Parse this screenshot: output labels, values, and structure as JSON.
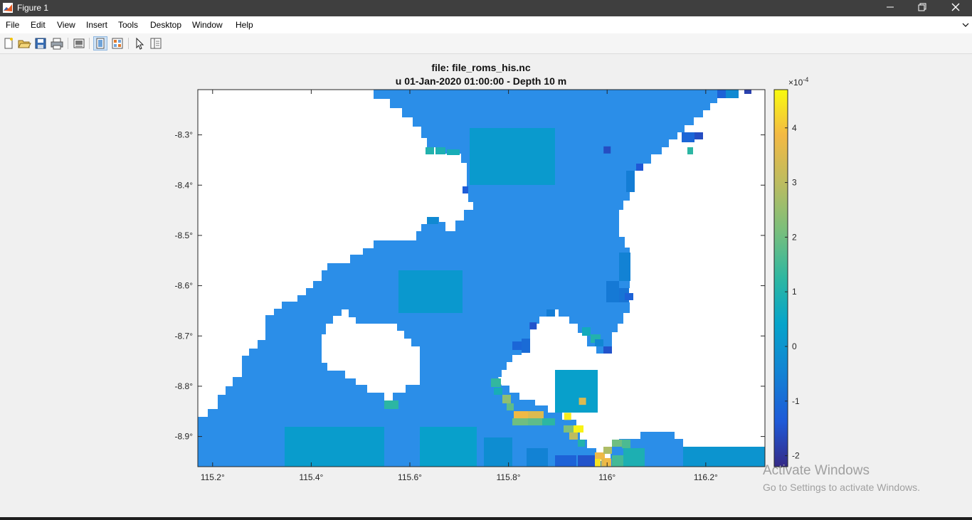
{
  "window": {
    "title": "Figure 1",
    "minimize_icon": "minimize-icon",
    "maximize_icon": "restore-icon",
    "close_icon": "close-icon"
  },
  "menu": {
    "items": [
      "File",
      "Edit",
      "View",
      "Insert",
      "Tools",
      "Desktop",
      "Window",
      "Help"
    ]
  },
  "toolbar": {
    "buttons": [
      "new-figure-icon",
      "open-file-icon",
      "save-icon",
      "print-icon",
      "link-plot-icon",
      "dock-icon",
      "undock-icon",
      "pointer-icon",
      "property-inspector-icon"
    ]
  },
  "plot": {
    "title_line1": "file: file_roms_his.nc",
    "title_line2": "u 01-Jan-2020 01:00:00  - Depth 10 m",
    "colorbar_exponent": "×10",
    "colorbar_exponent_power": "-4"
  },
  "watermark": {
    "line1": "Activate Windows",
    "line2": "Go to Settings to activate Windows."
  },
  "chart_data": {
    "type": "heatmap",
    "title": "file: file_roms_his.nc\nu 01-Jan-2020 01:00:00  - Depth 10 m",
    "xlim": [
      115.17,
      116.32
    ],
    "ylim": [
      -8.96,
      -8.21
    ],
    "x_ticks": [
      "115.2°",
      "115.4°",
      "115.6°",
      "115.8°",
      "116°",
      "116.2°"
    ],
    "x_tick_values": [
      115.2,
      115.4,
      115.6,
      115.8,
      116.0,
      116.2
    ],
    "y_ticks": [
      "-8.3°",
      "-8.4°",
      "-8.5°",
      "-8.6°",
      "-8.7°",
      "-8.8°",
      "-8.9°"
    ],
    "y_tick_values": [
      -8.3,
      -8.4,
      -8.5,
      -8.6,
      -8.7,
      -8.8,
      -8.9
    ],
    "colorbar": {
      "ticks": [
        "4",
        "3",
        "2",
        "1",
        "0",
        "-1",
        "-2"
      ],
      "tick_values": [
        4,
        3,
        2,
        1,
        0,
        -1,
        -2
      ],
      "range": [
        -2.2,
        4.7
      ],
      "scale_exponent": -4,
      "colormap": "parula"
    },
    "background_value_color": "#2b8ee8",
    "land_color": "#ffffff",
    "highlights": [
      {
        "lon": 115.95,
        "lat": -8.83,
        "value": 3.5
      },
      {
        "lon": 115.92,
        "lat": -8.86,
        "value": 4.5
      },
      {
        "lon": 116.0,
        "lat": -8.95,
        "value": 3.8
      },
      {
        "lon": 115.85,
        "lat": -8.68,
        "value": -1.5
      },
      {
        "lon": 116.0,
        "lat": -8.33,
        "value": -1.6
      }
    ]
  }
}
